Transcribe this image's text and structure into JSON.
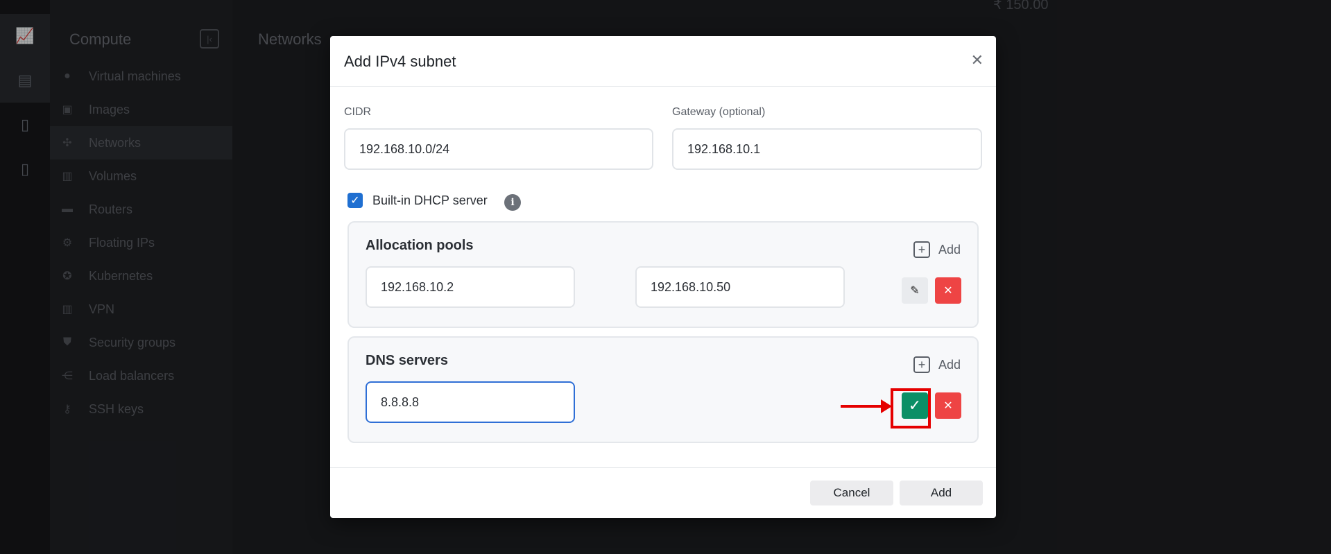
{
  "background": {
    "section_title": "Compute",
    "content_title": "Networks",
    "sidebar_items": [
      {
        "label": "Virtual machines",
        "icon": "vm-icon"
      },
      {
        "label": "Images",
        "icon": "image-icon"
      },
      {
        "label": "Networks",
        "icon": "network-icon"
      },
      {
        "label": "Volumes",
        "icon": "volume-icon"
      },
      {
        "label": "Routers",
        "icon": "router-icon"
      },
      {
        "label": "Floating IPs",
        "icon": "floating-ip-icon"
      },
      {
        "label": "Kubernetes",
        "icon": "kubernetes-icon"
      },
      {
        "label": "VPN",
        "icon": "vpn-icon"
      },
      {
        "label": "Security groups",
        "icon": "shield-icon"
      },
      {
        "label": "Load balancers",
        "icon": "load-balancer-icon"
      },
      {
        "label": "SSH keys",
        "icon": "key-icon"
      }
    ],
    "balance": "₹ 150.00"
  },
  "modal": {
    "title": "Add IPv4 subnet",
    "cidr_label": "CIDR",
    "cidr_value": "192.168.10.0/24",
    "gateway_label": "Gateway (optional)",
    "gateway_value": "192.168.10.1",
    "dhcp_label": "Built-in DHCP server",
    "dhcp_checked": true,
    "allocation_pools": {
      "title": "Allocation pools",
      "add_label": "Add",
      "start": "192.168.10.2",
      "end": "192.168.10.50"
    },
    "dns_servers": {
      "title": "DNS servers",
      "add_label": "Add",
      "value": "8.8.8.8"
    },
    "cancel_label": "Cancel",
    "submit_label": "Add"
  },
  "colors": {
    "accent": "#2f6fd6",
    "confirm": "#0b8f66",
    "danger": "#ee4444",
    "annotation": "#e50000"
  }
}
